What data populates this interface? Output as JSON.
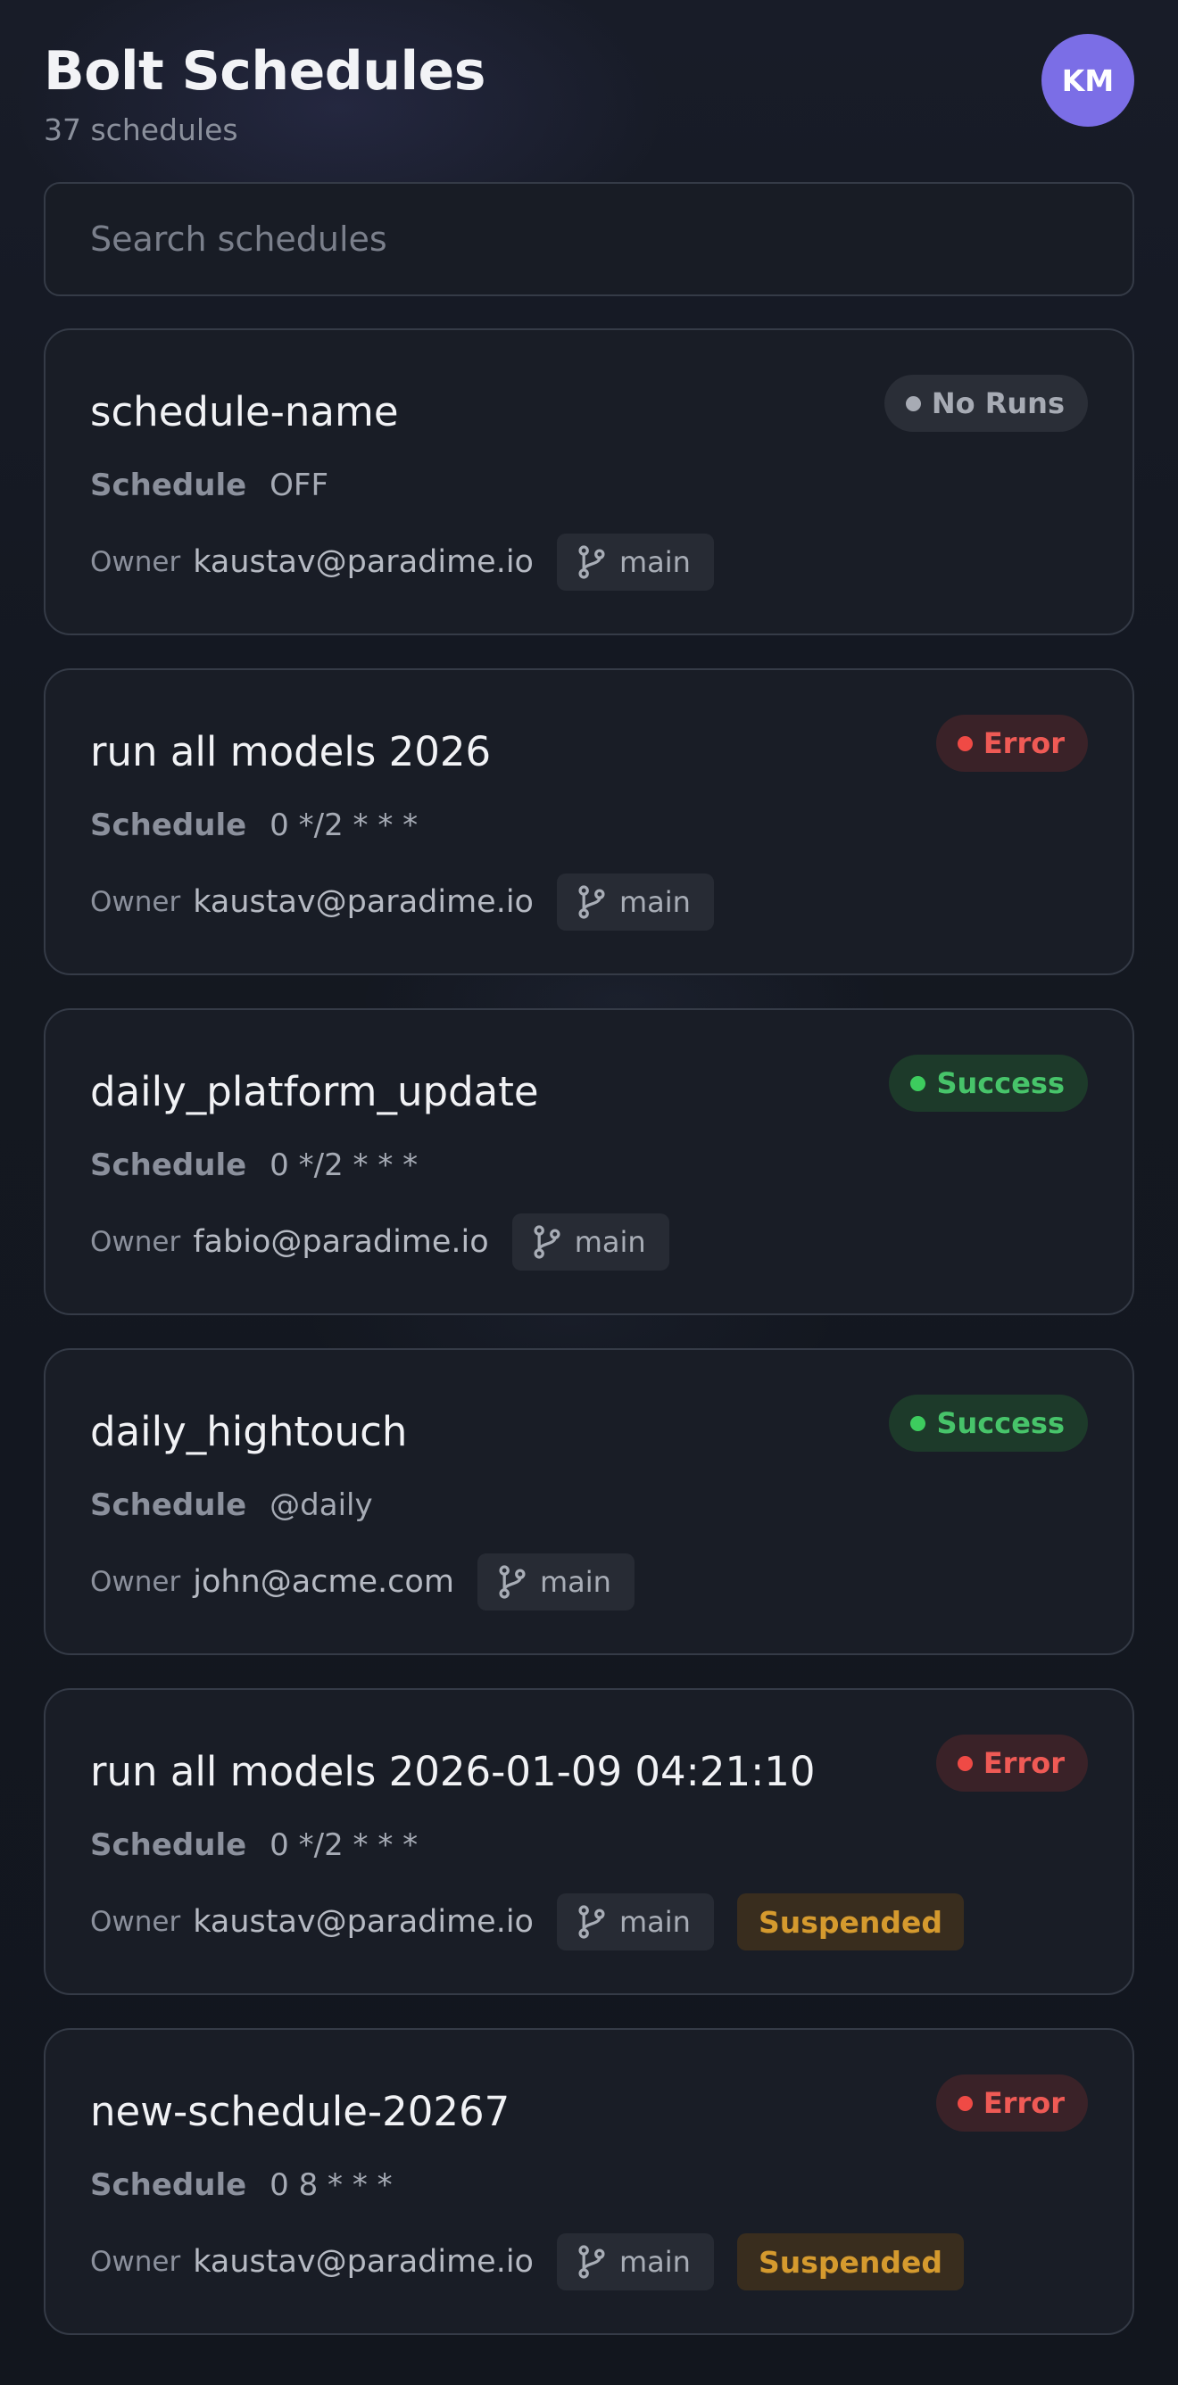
{
  "header": {
    "title": "Bolt Schedules",
    "count_label": "37 schedules",
    "avatar_initials": "KM"
  },
  "search": {
    "placeholder": "Search schedules"
  },
  "labels": {
    "schedule": "Schedule",
    "owner": "Owner"
  },
  "icons": {
    "branch": "git-branch-icon"
  },
  "colors": {
    "avatar": "#7b6ee6",
    "error": "#ef5a55",
    "success": "#47c46a",
    "suspended": "#d59a2e"
  },
  "schedules": [
    {
      "name": "schedule-name",
      "status": "No Runs",
      "status_kind": "none",
      "schedule": "OFF",
      "owner": "kaustav@paradime.io",
      "branch": "main",
      "suspended": null
    },
    {
      "name": "run all models 2026",
      "status": "Error",
      "status_kind": "error",
      "schedule": "0 */2 * * *",
      "owner": "kaustav@paradime.io",
      "branch": "main",
      "suspended": null
    },
    {
      "name": "daily_platform_update",
      "status": "Success",
      "status_kind": "success",
      "schedule": "0 */2 * * *",
      "owner": "fabio@paradime.io",
      "branch": "main",
      "suspended": null
    },
    {
      "name": "daily_hightouch",
      "status": "Success",
      "status_kind": "success",
      "schedule": "@daily",
      "owner": "john@acme.com",
      "branch": "main",
      "suspended": null
    },
    {
      "name": "run all models 2026-01-09 04:21:10",
      "status": "Error",
      "status_kind": "error",
      "schedule": "0 */2 * * *",
      "owner": "kaustav@paradime.io",
      "branch": "main",
      "suspended": "Suspended"
    },
    {
      "name": "new-schedule-20267",
      "status": "Error",
      "status_kind": "error",
      "schedule": "0 8 * * *",
      "owner": "kaustav@paradime.io",
      "branch": "main",
      "suspended": "Suspended"
    }
  ]
}
